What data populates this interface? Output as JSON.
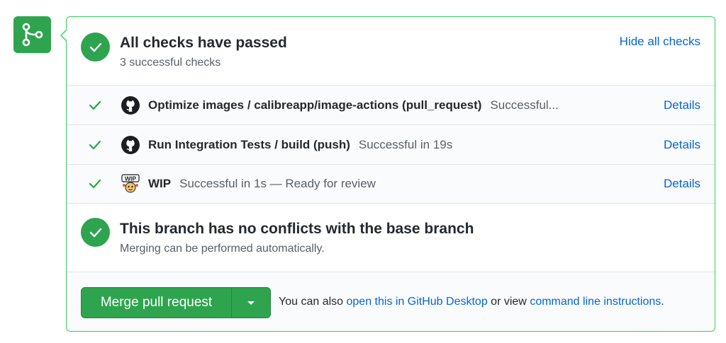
{
  "status": {
    "title": "All checks have passed",
    "subtitle": "3 successful checks",
    "hide_link": "Hide all checks"
  },
  "checks": [
    {
      "name": "Optimize images / calibreapp/image-actions (pull_request)",
      "desc": "Successful...",
      "details": "Details",
      "avatar": "github-icon"
    },
    {
      "name": "Run Integration Tests / build (push)",
      "desc": "Successful in 19s",
      "details": "Details",
      "avatar": "github-icon"
    },
    {
      "name": "WIP",
      "desc": "Successful in 1s — Ready for review",
      "details": "Details",
      "avatar": "wip-app-icon"
    }
  ],
  "conflicts": {
    "title": "This branch has no conflicts with the base branch",
    "subtitle": "Merging can be performed automatically."
  },
  "merge": {
    "button_label": "Merge pull request",
    "alt_prefix": "You can also",
    "desktop_link": "open this in GitHub Desktop",
    "alt_middle": "or view",
    "cli_link": "command line instructions",
    "alt_suffix": "."
  },
  "colors": {
    "success": "#2ea44f",
    "link": "#0366d6",
    "border": "#34d058"
  }
}
